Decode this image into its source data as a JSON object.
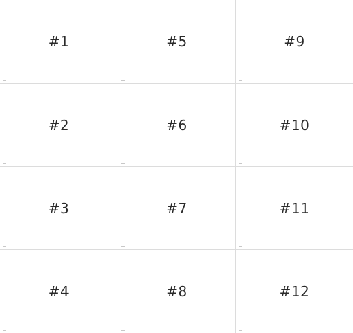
{
  "grid": {
    "tiles": [
      {
        "label": "#1"
      },
      {
        "label": "#2"
      },
      {
        "label": "#3"
      },
      {
        "label": "#4"
      },
      {
        "label": "#5"
      },
      {
        "label": "#6"
      },
      {
        "label": "#7"
      },
      {
        "label": "#8"
      },
      {
        "label": "#9"
      },
      {
        "label": "#10"
      },
      {
        "label": "#11"
      },
      {
        "label": "#12"
      }
    ]
  },
  "colors": {
    "background": "#ffffff",
    "divider": "#dcdcdc",
    "text": "#2a2a2a"
  }
}
